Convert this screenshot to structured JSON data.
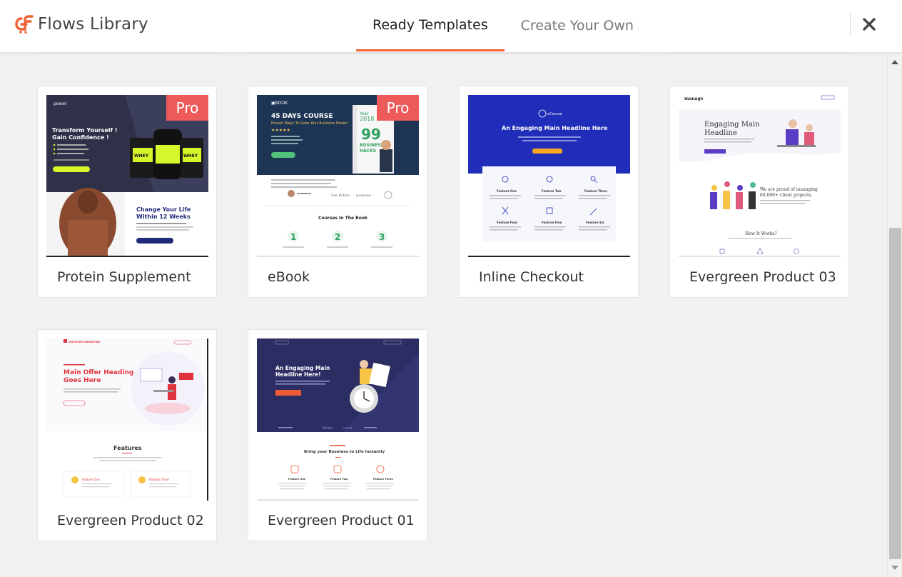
{
  "app": {
    "title": "Flows Library",
    "brand_color": "#f06335"
  },
  "tabs": [
    {
      "label": "Ready Templates",
      "active": true
    },
    {
      "label": "Create Your Own",
      "active": false
    }
  ],
  "icons": {
    "close": "close-icon",
    "logo": "cartflows-logo-icon"
  },
  "templates": [
    {
      "title": "Protein Supplement",
      "badge": "Pro",
      "preview": {
        "headline": "Transform Yourself ! Gain Confidence !",
        "subheadline": "Change Your Life Within 12 Weeks",
        "brand": "power",
        "product": "WHEY PROTEIN"
      }
    },
    {
      "title": "eBook",
      "badge": "Pro",
      "preview": {
        "brand": "BOOK",
        "headline": "45 DAYS COURSE",
        "subheadline": "Proven Ways To Grow Your Business Faster!",
        "book_number": "99",
        "book_text": "BUSINESS HACKS",
        "book_year": "2018",
        "section": "Courses In The Book",
        "steps": [
          "1",
          "2",
          "3"
        ],
        "logos": [
          "Les Echos",
          "HARVARD",
          "L'OFFICIEL"
        ]
      }
    },
    {
      "title": "Inline Checkout",
      "badge": "",
      "preview": {
        "brand": "eCourse",
        "headline": "An Engaging Main Headline Here",
        "button": "Buy Course Now",
        "features": [
          "Feature One",
          "Feature Two",
          "Feature Three",
          "Feature Four",
          "Feature Five",
          "Feature Six"
        ]
      }
    },
    {
      "title": "Evergreen Product 03",
      "badge": "",
      "preview": {
        "brand": "manage",
        "headline": "Engaging Main Headline",
        "section": "We are proud of managing 60,000+ client projects.",
        "footer_heading": "How It Works?"
      }
    },
    {
      "title": "Evergreen Product 02",
      "badge": "",
      "preview": {
        "brand": "DISCOVER MARKETING",
        "headline": "Main Offer Heading Goes Here",
        "section": "Features",
        "features": [
          "Feature One",
          "Feature Three"
        ]
      }
    },
    {
      "title": "Evergreen Product 01",
      "badge": "",
      "preview": {
        "headline": "An Engaging Main Headline Here!",
        "button": "Buy It Now",
        "section": "Bring your Business to Life Instantly",
        "features": [
          "Feature One",
          "Feature Two",
          "Feature Three"
        ],
        "logos": [
          "Sketch",
          "Bellas",
          "Lotus"
        ]
      }
    }
  ]
}
